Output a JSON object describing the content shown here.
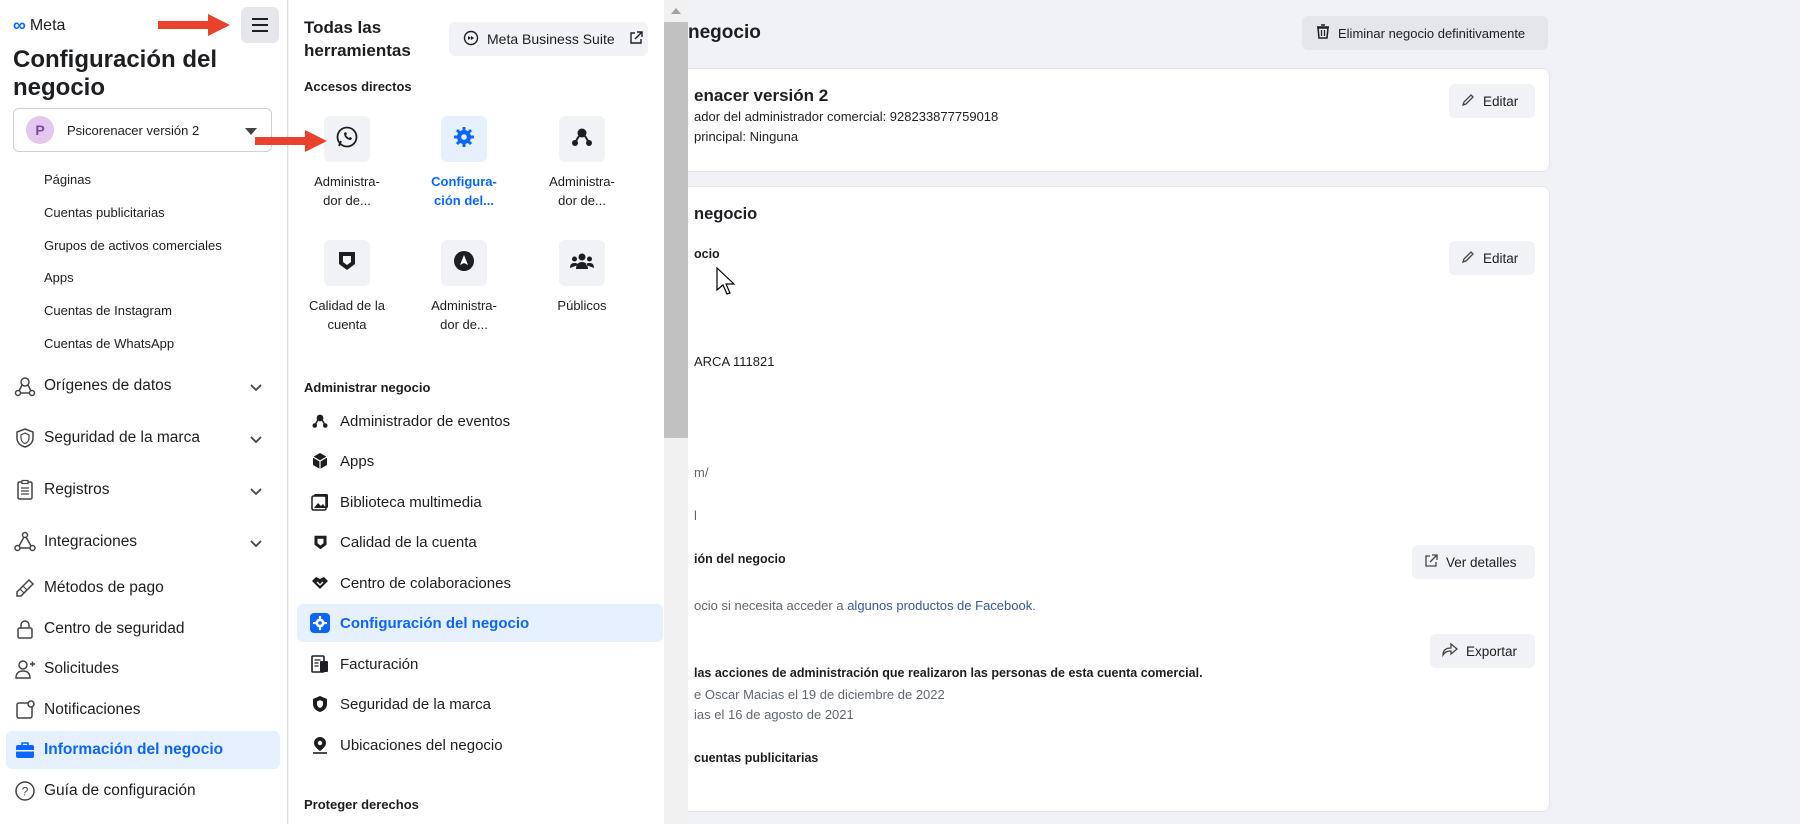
{
  "sidebar": {
    "logo_text": "Meta",
    "title": "Configuración del negocio",
    "account": {
      "initial": "P",
      "name": "Psicorenacer versión 2"
    },
    "sub_items": [
      "Páginas",
      "Cuentas publicitarias",
      "Grupos de activos comerciales",
      "Apps",
      "Cuentas de Instagram",
      "Cuentas de WhatsApp"
    ],
    "nav": [
      {
        "label": "Orígenes de datos",
        "icon": "data-sources-icon",
        "expand": true
      },
      {
        "label": "Seguridad de la marca",
        "icon": "shield-icon",
        "expand": true
      },
      {
        "label": "Registros",
        "icon": "clipboard-icon",
        "expand": true
      },
      {
        "label": "Integraciones",
        "icon": "integrations-icon",
        "expand": true
      },
      {
        "label": "Métodos de pago",
        "icon": "pencil-card-icon",
        "expand": false
      },
      {
        "label": "Centro de seguridad",
        "icon": "lock-icon",
        "expand": false
      },
      {
        "label": "Solicitudes",
        "icon": "person-add-icon",
        "expand": false
      },
      {
        "label": "Notificaciones",
        "icon": "notification-icon",
        "expand": false
      },
      {
        "label": "Información del negocio",
        "icon": "briefcase-icon",
        "expand": false,
        "active": true
      },
      {
        "label": "Guía de configuración",
        "icon": "question-icon",
        "expand": false
      }
    ]
  },
  "tools": {
    "title": "Todas las herramientas",
    "mbs_button": "Meta Business Suite",
    "shortcuts_label": "Accesos directos",
    "tiles": [
      {
        "line1": "Administra-",
        "line2": "dor de...",
        "icon": "whatsapp-icon"
      },
      {
        "line1": "Configura-",
        "line2": "ción del...",
        "icon": "gear-icon",
        "selected": true
      },
      {
        "line1": "Administra-",
        "line2": "dor de...",
        "icon": "events-icon"
      },
      {
        "line1": "Calidad de la",
        "line2": "cuenta",
        "icon": "shield-quality-icon"
      },
      {
        "line1": "Administra-",
        "line2": "dor de...",
        "icon": "compass-icon"
      },
      {
        "line1": "Públicos",
        "line2": "",
        "icon": "audience-icon"
      }
    ],
    "manage_label": "Administrar negocio",
    "items": [
      {
        "label": "Administrador de eventos",
        "icon": "events-icon"
      },
      {
        "label": "Apps",
        "icon": "cube-icon"
      },
      {
        "label": "Biblioteca multimedia",
        "icon": "media-icon"
      },
      {
        "label": "Calidad de la cuenta",
        "icon": "shield-quality-icon"
      },
      {
        "label": "Centro de colaboraciones",
        "icon": "handshake-icon"
      },
      {
        "label": "Configuración del negocio",
        "icon": "gear-icon",
        "active": true
      },
      {
        "label": "Facturación",
        "icon": "billing-icon"
      },
      {
        "label": "Seguridad de la marca",
        "icon": "brand-safety-icon"
      },
      {
        "label": "Ubicaciones del negocio",
        "icon": "location-icon"
      }
    ],
    "protect_label": "Proteger derechos"
  },
  "main": {
    "title": "negocio",
    "delete_button": "Eliminar negocio definitivamente",
    "card1": {
      "name": "enacer versión 2",
      "admin_id": "ador del administrador comercial: 928233877759018",
      "principal": "principal: Ninguna",
      "edit": "Editar"
    },
    "card2": {
      "title": "negocio",
      "sub": "ocio",
      "edit": "Editar",
      "brand": "ARCA 111821",
      "url_frag": "m/",
      "frag2": "l",
      "verif_title": "ión del negocio",
      "verif_text": "ocio si necesita acceder a ",
      "verif_link": "algunos productos de Facebook",
      "verif_tail": ".",
      "details_button": "Ver detalles",
      "export_button": "Exportar",
      "actions_title": "las acciones de administración que realizaron las personas de esta cuenta comercial.",
      "line1": "e Oscar Macias el 19 de diciembre de 2022",
      "line2": "ias el 16 de agosto de 2021",
      "ads_title": "cuentas publicitarias"
    }
  },
  "colors": {
    "accent": "#0a66ff",
    "active_bg": "#e7f0fe",
    "arrow": "#e8412c"
  }
}
